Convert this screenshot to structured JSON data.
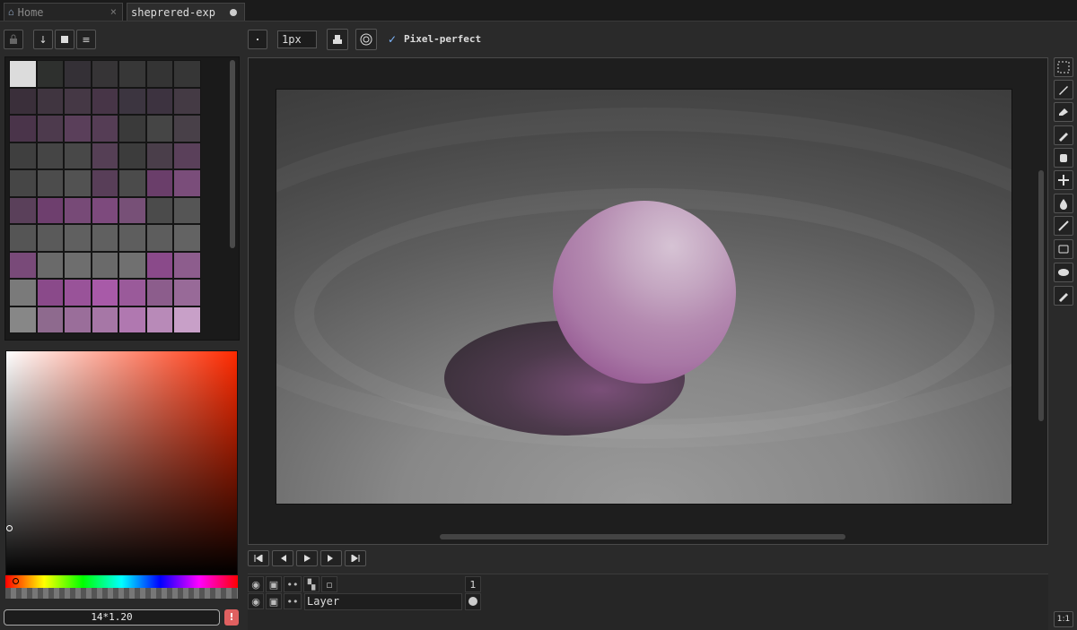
{
  "tabs": [
    {
      "label": "Home",
      "close_icon": "×"
    },
    {
      "label": "sheprered-exp"
    }
  ],
  "palette": {
    "colors": [
      "#dcdcdc",
      "#2e302e",
      "#343036",
      "#363436",
      "#373737",
      "#343434",
      "#363636",
      "#3a2f3a",
      "#403540",
      "#453845",
      "#473547",
      "#3c3540",
      "#3d3340",
      "#443a44",
      "#4a344a",
      "#4d3a4d",
      "#5a3f5a",
      "#553d55",
      "#3a3a3a",
      "#454545",
      "#484048",
      "#3f3f3f",
      "#454545",
      "#484848",
      "#553f55",
      "#3c3c3c",
      "#4a3e4a",
      "#5a405a",
      "#464646",
      "#4c4c4c",
      "#525252",
      "#583e58",
      "#4b4b4b",
      "#6a3e6a",
      "#7a4d7a",
      "#5a405a",
      "#6e3f6e",
      "#774a77",
      "#7d4a7d",
      "#775077",
      "#4b4b4b",
      "#555555",
      "#555555",
      "#5a5a5a",
      "#606060",
      "#606060",
      "#5e5e5e",
      "#5d5d5d",
      "#636363",
      "#794a79",
      "#6a6a6a",
      "#6e6e6e",
      "#6a6a6a",
      "#707070",
      "#8a4a8a",
      "#8d5d8d",
      "#7a7a7a",
      "#8a4a8a",
      "#995399",
      "#a85aa8",
      "#9a5a9a",
      "#8c5d8c",
      "#986a98",
      "#878787",
      "#8e6a8e",
      "#9a6e9a",
      "#a677a6",
      "#b078b0",
      "#b88ab8",
      "#c8a0c8"
    ]
  },
  "color_picker": {
    "value": "14*1.20",
    "warn": "!"
  },
  "toolbar": {
    "brush_size": "1px",
    "pixel_perfect": "Pixel-perfect",
    "check": "✓"
  },
  "timeline": {
    "frame_number": "1",
    "layer_name": "Layer"
  },
  "zoom_button": "1:1",
  "buttons": {
    "nav_down": "↓",
    "menu": "≡"
  }
}
